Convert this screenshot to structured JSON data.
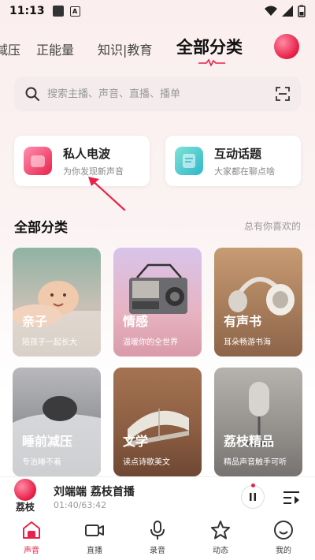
{
  "status_bar": {
    "time": "11:13",
    "badge": "A"
  },
  "top_nav": {
    "tabs": [
      "减压",
      "正能量",
      "知识|教育",
      "全部分类"
    ],
    "active_index": 3
  },
  "search": {
    "placeholder": "搜索主播、声音、直播、播单"
  },
  "features": [
    {
      "title": "私人电波",
      "subtitle": "为你发现新声音"
    },
    {
      "title": "互动话题",
      "subtitle": "大家都在聊点啥"
    }
  ],
  "section": {
    "title": "全部分类",
    "side_text": "总有你喜欢的"
  },
  "categories": [
    {
      "name": "亲子",
      "desc": "陪孩子一起长大"
    },
    {
      "name": "情感",
      "desc": "温暖你的全世界"
    },
    {
      "name": "有声书",
      "desc": "耳朵畅游书海"
    },
    {
      "name": "睡前减压",
      "desc": "专治睡不着"
    },
    {
      "name": "文学",
      "desc": "读点诗歌美文"
    },
    {
      "name": "荔枝精品",
      "desc": "精品声音触手可听"
    }
  ],
  "player": {
    "brand": "荔枝",
    "title": "刘端端  荔枝首播",
    "time": "01:40/63:42"
  },
  "bottom_nav": {
    "items": [
      "声音",
      "直播",
      "录音",
      "动态",
      "我的"
    ],
    "active_index": 0
  },
  "colors": {
    "accent": "#e8234a"
  }
}
